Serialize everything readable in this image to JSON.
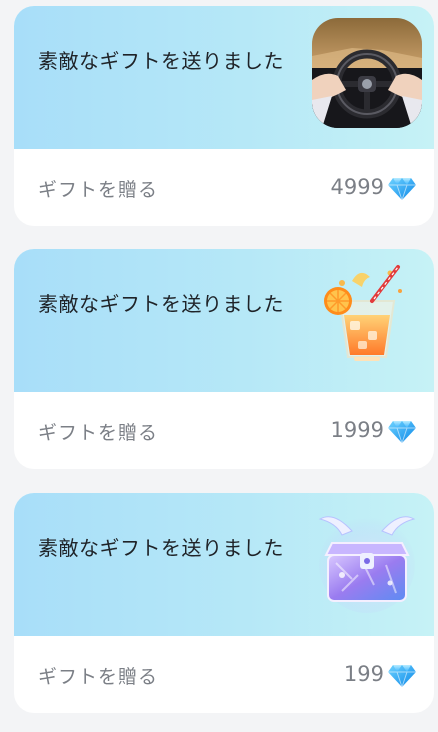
{
  "gifts": [
    {
      "title": "素敵なギフトを送りました",
      "action_label": "ギフトを贈る",
      "price": "4999",
      "gift_icon": "steering-wheel-car-gift-icon",
      "currency_icon": "diamond-icon"
    },
    {
      "title": "素敵なギフトを送りました",
      "action_label": "ギフトを贈る",
      "price": "1999",
      "gift_icon": "orange-juice-gift-icon",
      "currency_icon": "diamond-icon"
    },
    {
      "title": "素敵なギフトを送りました",
      "action_label": "ギフトを贈る",
      "price": "199",
      "gift_icon": "winged-treasure-chest-gift-icon",
      "currency_icon": "diamond-icon"
    }
  ],
  "colors": {
    "card_gradient_start": "#a8def9",
    "card_gradient_end": "#c6f2f6",
    "diamond_blue": "#1aa3f5",
    "muted_text": "#7b7f86"
  }
}
